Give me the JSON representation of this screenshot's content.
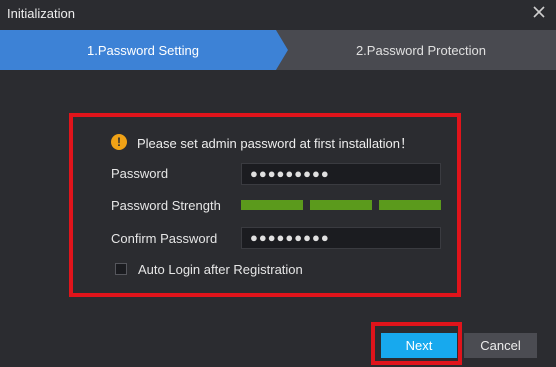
{
  "window": {
    "title": "Initialization"
  },
  "steps": [
    {
      "label": "1.Password Setting",
      "active": true
    },
    {
      "label": "2.Password Protection",
      "active": false
    }
  ],
  "form": {
    "notice": "Please set admin password at first installation！",
    "password_label": "Password",
    "password_value": "●●●●●●●●●",
    "strength_label": "Password Strength",
    "strength_level": 1.0,
    "confirm_label": "Confirm Password",
    "confirm_value": "●●●●●●●●●",
    "auto_login_label": "Auto Login after Registration",
    "auto_login_checked": false
  },
  "buttons": {
    "next": "Next",
    "cancel": "Cancel"
  },
  "colors": {
    "background": "#2b2c30",
    "active_step": "#3d82d6",
    "inactive_step": "#494a50",
    "strength_bar": "#5b9a1c",
    "primary_button": "#17a9ee",
    "highlight": "#e0141b"
  },
  "icons": {
    "close": "close-icon",
    "warning": "warning-icon"
  }
}
